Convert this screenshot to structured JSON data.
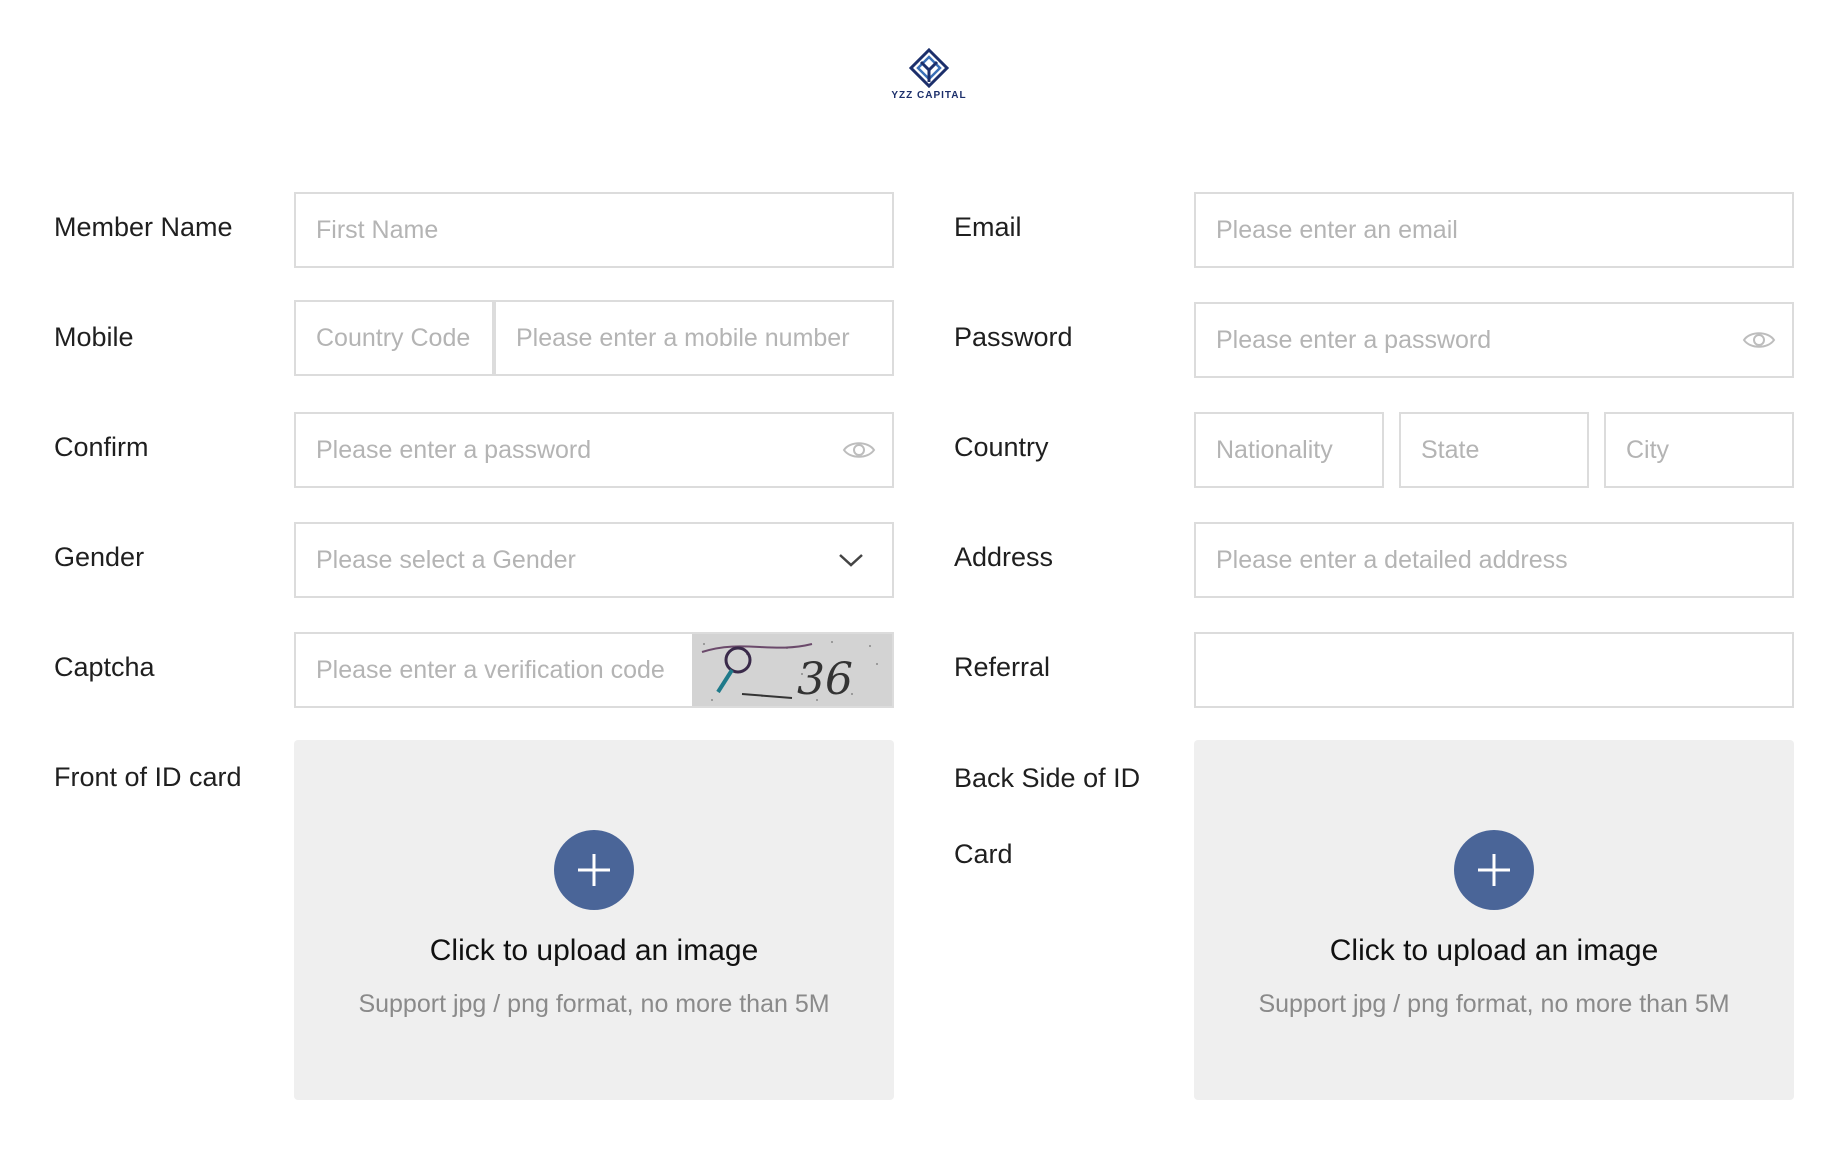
{
  "brand": {
    "name": "YZZ CAPITAL",
    "color": "#1c2f6b"
  },
  "colors": {
    "accent": "#4a6598",
    "border": "#dcdcdc",
    "placeholder": "#b4b4b4",
    "upload_bg": "#efefef"
  },
  "form": {
    "member_name": {
      "label": "Member Name",
      "placeholder": "First Name"
    },
    "email": {
      "label": "Email",
      "placeholder": "Please enter an email"
    },
    "mobile": {
      "label": "Mobile",
      "country_code_placeholder": "Country Code",
      "number_placeholder": "Please enter a mobile number"
    },
    "password": {
      "label": "Password",
      "placeholder": "Please enter a password",
      "icon": "eye-icon"
    },
    "confirm": {
      "label": "Confirm",
      "placeholder": "Please enter a password",
      "icon": "eye-icon"
    },
    "country": {
      "label": "Country",
      "nationality_placeholder": "Nationality",
      "state_placeholder": "State",
      "city_placeholder": "City"
    },
    "gender": {
      "label": "Gender",
      "placeholder": "Please select a Gender",
      "icon": "chevron-down-icon"
    },
    "address": {
      "label": "Address",
      "placeholder": "Please enter a detailed address"
    },
    "captcha": {
      "label": "Captcha",
      "placeholder": "Please enter a verification code",
      "image_text": "36"
    },
    "referral": {
      "label": "Referral",
      "value": ""
    },
    "front_id": {
      "label": "Front of ID card",
      "upload_title": "Click to upload an image",
      "upload_hint": "Support jpg / png format, no more than 5M",
      "icon": "plus-icon"
    },
    "back_id": {
      "label": "Back Side of ID Card",
      "upload_title": "Click to upload an image",
      "upload_hint": "Support jpg / png format, no more than 5M",
      "icon": "plus-icon"
    }
  }
}
